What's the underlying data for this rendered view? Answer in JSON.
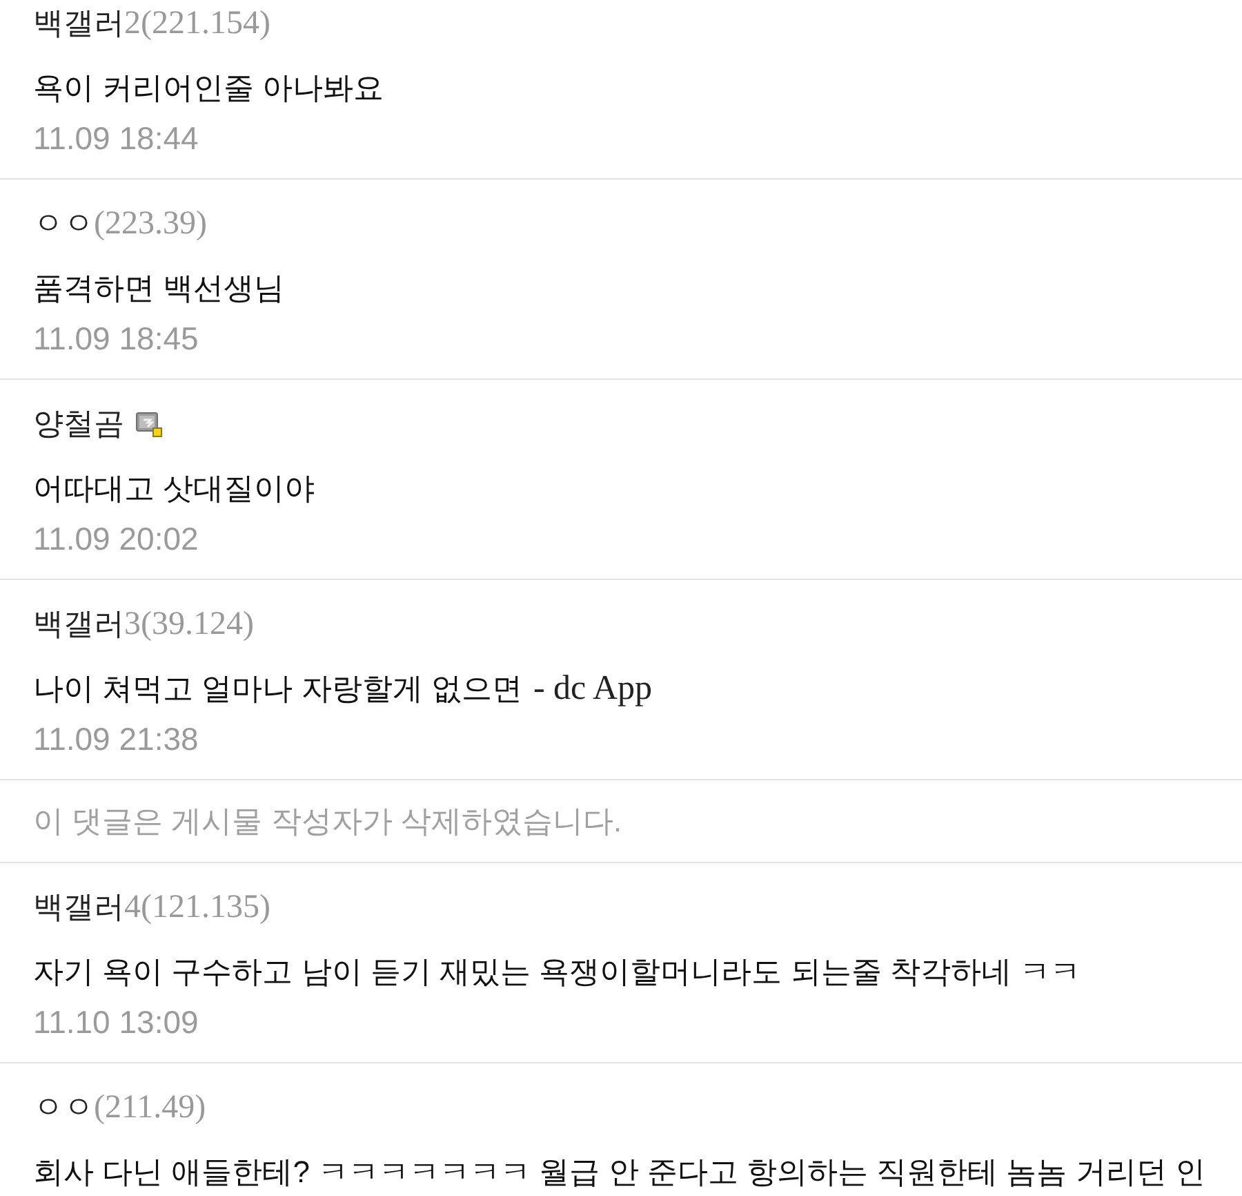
{
  "comments": [
    {
      "kind": "comment",
      "nickname": "백갤러",
      "ip": "2(221.154)",
      "nick_icon": false,
      "text": "욕이 커리어인줄 아나봐요",
      "date": "11.09 18:44"
    },
    {
      "kind": "comment",
      "nickname": "ㅇㅇ",
      "ip": "(223.39)",
      "nick_icon": false,
      "text": "품격하면 백선생님",
      "date": "11.09 18:45"
    },
    {
      "kind": "comment",
      "nickname": "양철곰",
      "nick_icon": true,
      "text": "어따대고 삿대질이야",
      "date": "11.09 20:02"
    },
    {
      "kind": "comment",
      "nickname": "백갤러",
      "ip": "3(39.124)",
      "nick_icon": false,
      "text": "나이 쳐먹고 얼마나 자랑할게 없으면",
      "app_tag": "- dc App",
      "date": "11.09 21:38"
    },
    {
      "kind": "deleted",
      "text": "이 댓글은 게시물 작성자가 삭제하였습니다."
    },
    {
      "kind": "comment",
      "nickname": "백갤러",
      "ip": "4(121.135)",
      "nick_icon": false,
      "text": "자기 욕이 구수하고 남이 듣기 재밌는 욕쟁이할머니라도 되는줄 착각하네 ㅋㅋ",
      "date": "11.10 13:09"
    },
    {
      "kind": "comment",
      "nickname": "ㅇㅇ",
      "ip": "(211.49)",
      "nick_icon": false,
      "text": "회사 다닌 애들한테? ㅋㅋㅋㅋㅋㅋㅋ 월급 안 준다고 항의하는 직원한테 놈놈 거리던 인"
    }
  ]
}
